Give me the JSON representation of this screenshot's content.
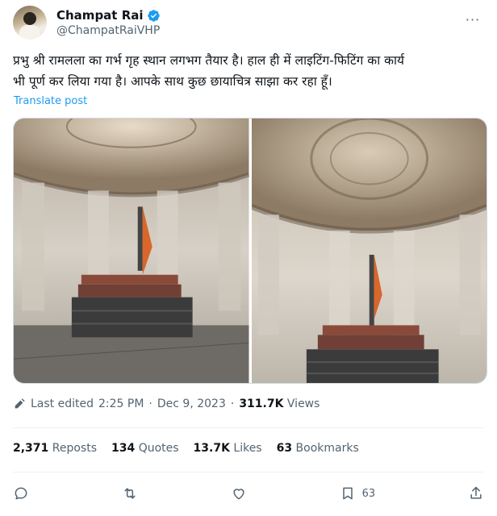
{
  "author": {
    "display_name": "Champat Rai",
    "handle": "@ChampatRaiVHP",
    "verified": true
  },
  "post": {
    "text_line1": "प्रभु श्री रामलला का गर्भ गृह स्थान लगभग तैयार है। हाल ही में लाइटिंग-फिटिंग का कार्य",
    "text_line2": "भी पूर्ण कर लिया गया है। आपके साथ कुछ छायाचित्र साझा कर रहा हूँ।",
    "translate_label": "Translate post",
    "edited_label": "Last edited",
    "time": "2:25 PM",
    "date": "Dec 9, 2023",
    "views_count": "311.7K",
    "views_label": "Views"
  },
  "stats": {
    "reposts_count": "2,371",
    "reposts_label": "Reposts",
    "quotes_count": "134",
    "quotes_label": "Quotes",
    "likes_count": "13.7K",
    "likes_label": "Likes",
    "bookmarks_count": "63",
    "bookmarks_label": "Bookmarks"
  },
  "actions": {
    "reply_icon": "reply-icon",
    "repost_icon": "repost-icon",
    "like_icon": "heart-icon",
    "bookmark_icon": "bookmark-icon",
    "bookmark_count": "63",
    "share_icon": "share-icon"
  },
  "colors": {
    "accent": "#1d9bf0",
    "text": "#0f1419",
    "secondary": "#536471"
  }
}
